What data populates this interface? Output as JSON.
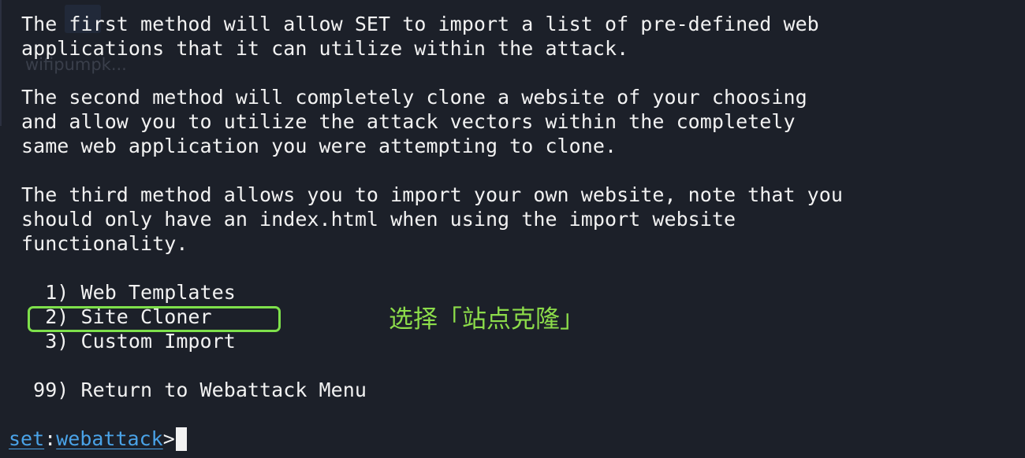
{
  "background_label": "wifipumpk...",
  "paragraphs": [
    {
      "lines": [
        "The first method will allow SET to import a list of pre-defined web",
        "applications that it can utilize within the attack."
      ]
    },
    {
      "lines": [
        "The second method will completely clone a website of your choosing",
        "and allow you to utilize the attack vectors within the completely",
        "same web application you were attempting to clone."
      ]
    },
    {
      "lines": [
        "The third method allows you to import your own website, note that you",
        "should only have an index.html when using the import website",
        "functionality."
      ]
    }
  ],
  "menu": [
    {
      "text": "  1) Web Templates"
    },
    {
      "text": "  2) Site Cloner"
    },
    {
      "text": "  3) Custom Import"
    },
    {
      "text": " 99) Return to Webattack Menu"
    }
  ],
  "annotation": "选择「站点克隆」",
  "prompt": {
    "module": "set",
    "separator": ":",
    "submodule": "webattack",
    "symbol": ">"
  },
  "colors": {
    "background": "#1c2029",
    "text": "#f2f2f2",
    "highlight": "#7ee04b",
    "annotation": "#8cdc4a",
    "prompt_link": "#4aa3e8"
  }
}
